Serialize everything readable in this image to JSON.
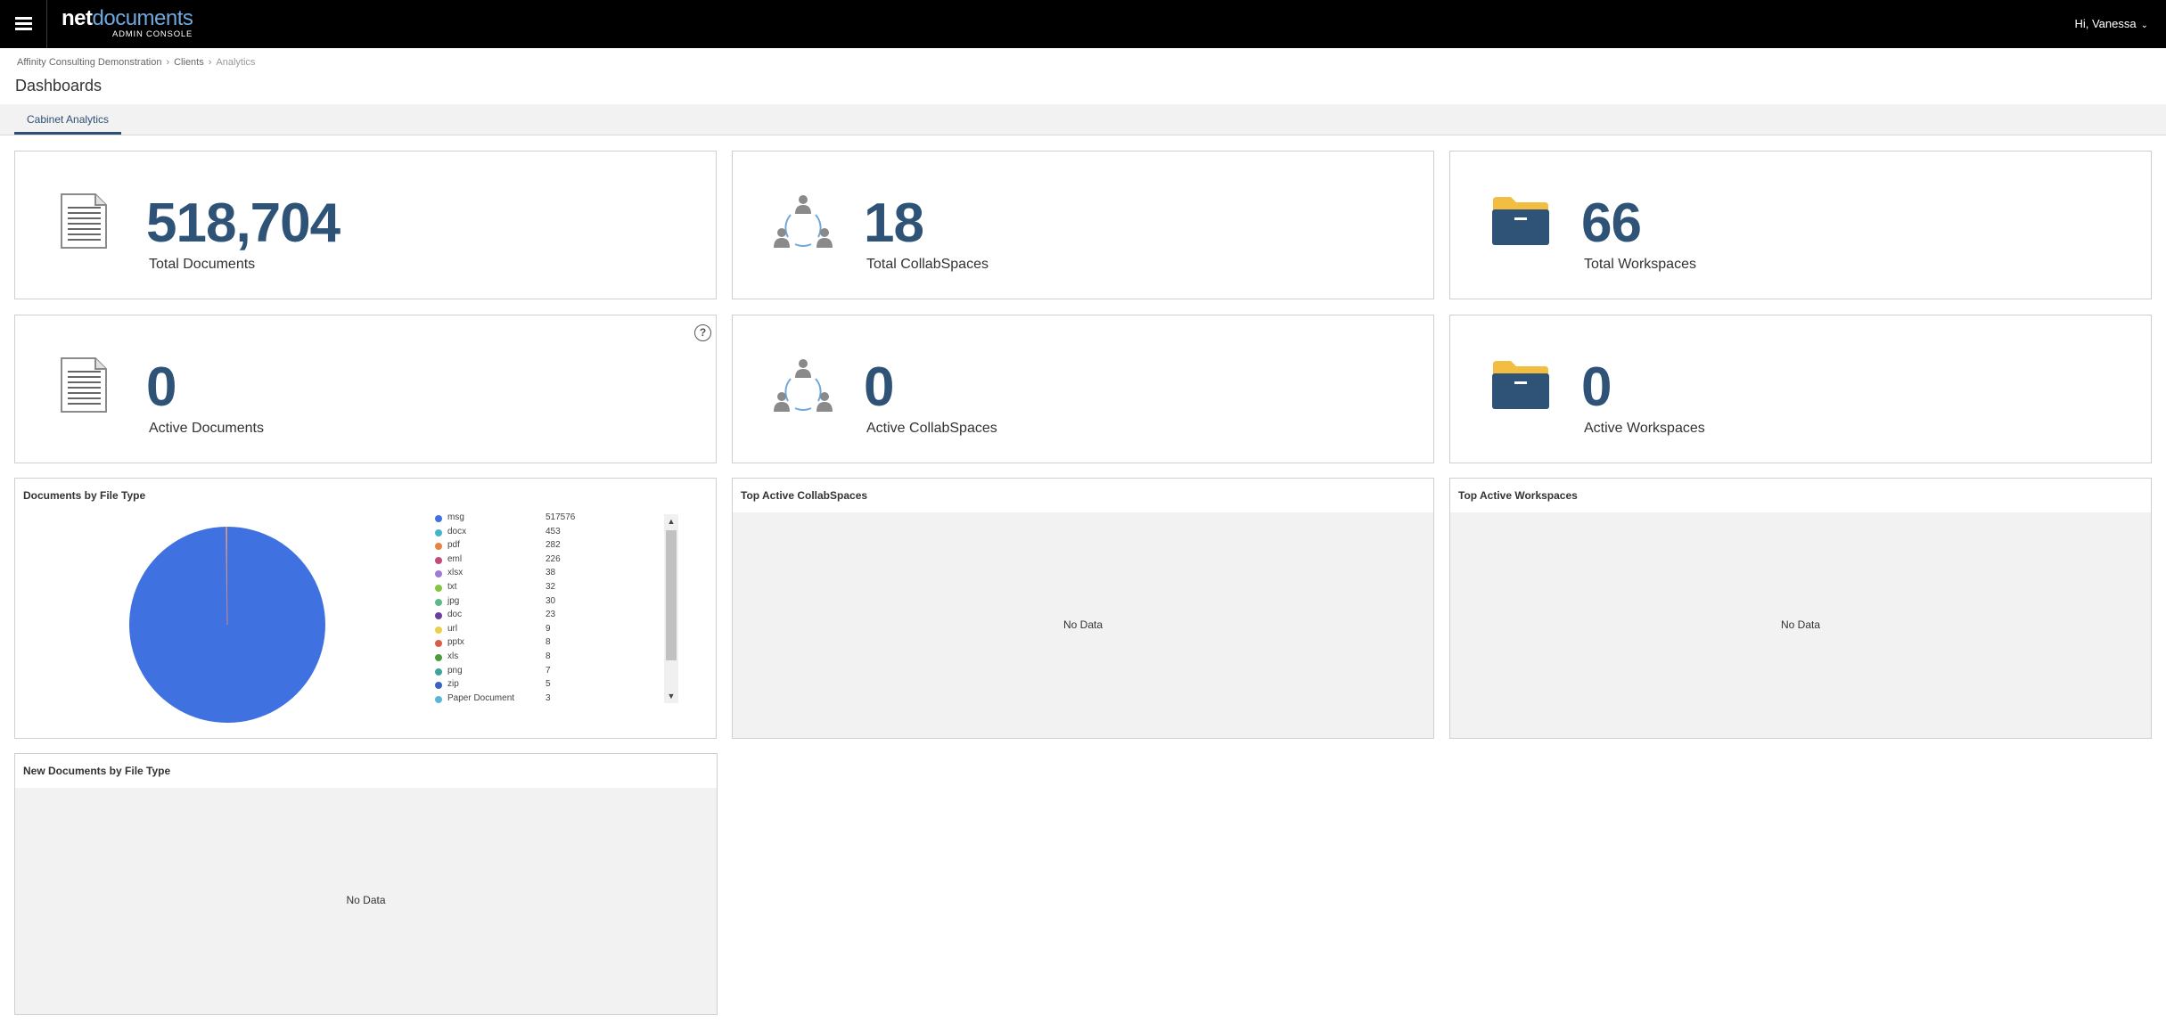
{
  "header": {
    "brand_bold": "net",
    "brand_light": "documents",
    "brand_sub": "ADMIN CONSOLE",
    "user_greeting": "Hi, Vanessa",
    "user_chevron": "⌄"
  },
  "breadcrumb": {
    "items": [
      "Affinity Consulting Demonstration",
      "Clients"
    ],
    "current": "Analytics",
    "separator": "›"
  },
  "page_title": "Dashboards",
  "tabs": [
    {
      "label": "Cabinet Analytics",
      "active": true
    }
  ],
  "stats": [
    {
      "value": "518,704",
      "label": "Total Documents",
      "icon": "document-icon"
    },
    {
      "value": "18",
      "label": "Total CollabSpaces",
      "icon": "collabspace-icon"
    },
    {
      "value": "66",
      "label": "Total Workspaces",
      "icon": "workspace-folder-icon"
    },
    {
      "value": "0",
      "label": "Active Documents",
      "icon": "document-icon",
      "help": "?"
    },
    {
      "value": "0",
      "label": "Active CollabSpaces",
      "icon": "collabspace-icon"
    },
    {
      "value": "0",
      "label": "Active Workspaces",
      "icon": "workspace-folder-icon"
    }
  ],
  "panels": {
    "file_type_title": "Documents by File Type",
    "top_collab_title": "Top Active CollabSpaces",
    "top_collab_empty": "No Data",
    "top_workspaces_title": "Top Active Workspaces",
    "top_workspaces_empty": "No Data",
    "new_docs_title": "New Documents by File Type",
    "new_docs_empty": "No Data"
  },
  "scroll": {
    "up": "▲",
    "down": "▼"
  },
  "colors": {
    "stat_value": "#2e5377",
    "pie_main": "#3f72e0",
    "folder_top": "#f3bd41",
    "folder_body": "#2e5377"
  },
  "chart_data": {
    "type": "pie",
    "title": "Documents by File Type",
    "legend_position": "right",
    "slices": [
      {
        "label": "msg",
        "value": 517576,
        "color": "#3f72e0"
      },
      {
        "label": "docx",
        "value": 453,
        "color": "#44b5c8"
      },
      {
        "label": "pdf",
        "value": 282,
        "color": "#e6833f"
      },
      {
        "label": "eml",
        "value": 226,
        "color": "#c44a7a"
      },
      {
        "label": "xlsx",
        "value": 38,
        "color": "#a07ad6"
      },
      {
        "label": "txt",
        "value": 32,
        "color": "#84c542"
      },
      {
        "label": "jpg",
        "value": 30,
        "color": "#5cb88a"
      },
      {
        "label": "doc",
        "value": 23,
        "color": "#6a3f9e"
      },
      {
        "label": "url",
        "value": 9,
        "color": "#ecd04a"
      },
      {
        "label": "pptx",
        "value": 8,
        "color": "#d95e4a"
      },
      {
        "label": "xls",
        "value": 8,
        "color": "#4f9a3c"
      },
      {
        "label": "png",
        "value": 7,
        "color": "#3fa39a"
      },
      {
        "label": "zip",
        "value": 5,
        "color": "#3a62c4"
      },
      {
        "label": "Paper Document",
        "value": 3,
        "color": "#5ab6d6"
      }
    ]
  }
}
